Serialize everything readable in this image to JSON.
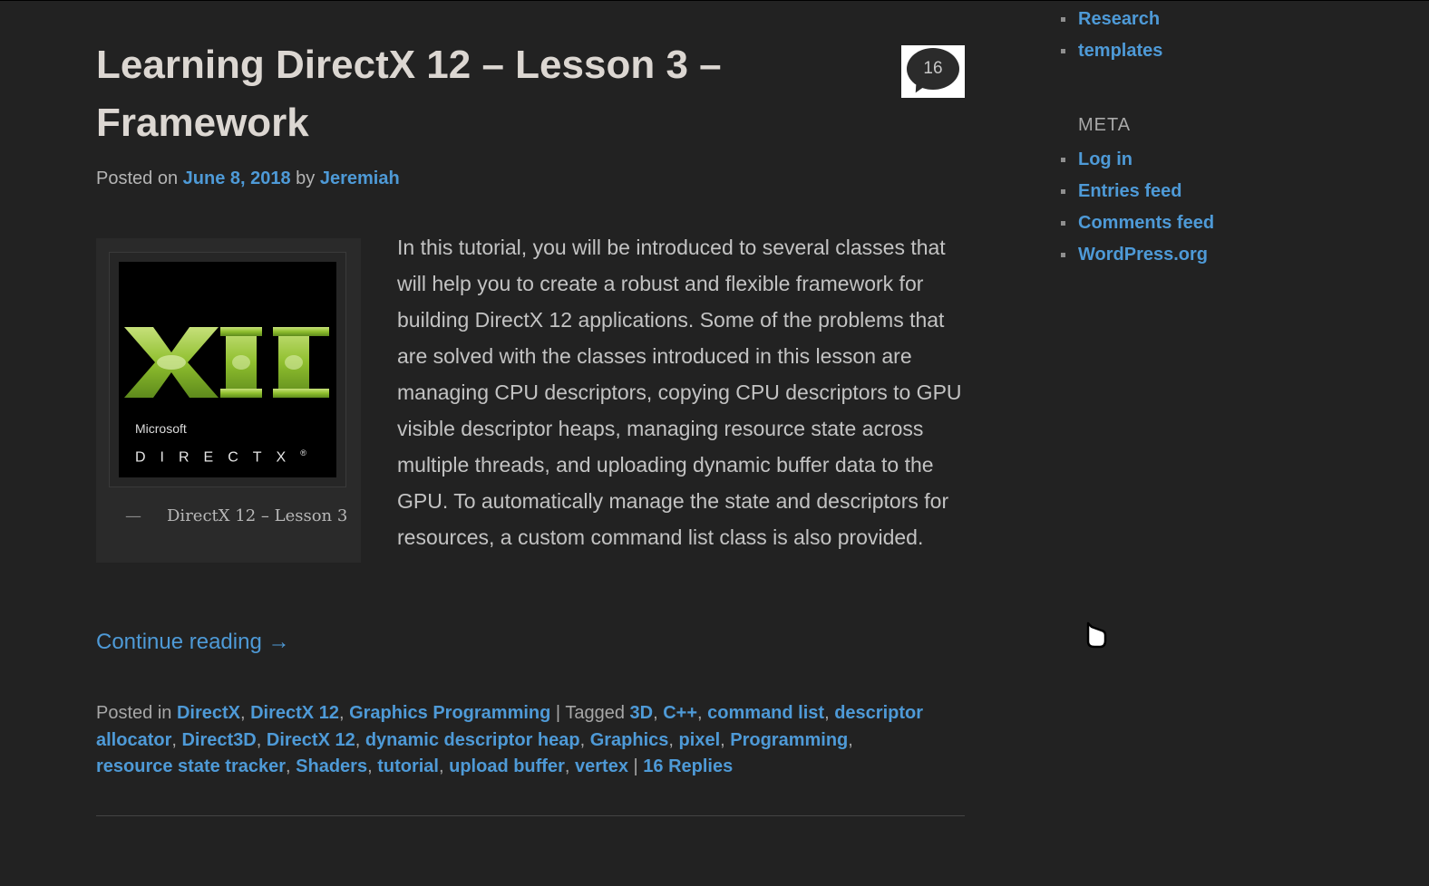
{
  "post": {
    "title": "Learning DirectX 12 – Lesson 3 – Framework",
    "comment_count": "16",
    "posted_on_label": "Posted on",
    "date": "June 8, 2018",
    "by_label": "by",
    "author": "Jeremiah",
    "image_caption": "DirectX 12 – Lesson 3",
    "image_caption_dash": "—",
    "logo_microsoft": "Microsoft",
    "logo_directx": "DIRECTX",
    "logo_registered": "®",
    "excerpt": "In this tutorial, you will be introduced to several classes that will help you to create a robust and flexible framework for building DirectX 12 applications. Some of the problems that are solved with the classes introduced in this lesson are managing CPU descriptors, copying CPU descriptors to GPU visible descriptor heaps, managing resource state across multiple threads, and uploading dynamic buffer data to the GPU. To automatically manage the state and descriptors for resources, a custom command list class is also provided.",
    "continue_reading": "Continue reading →",
    "posted_in_label": "Posted in",
    "categories": [
      "DirectX",
      "DirectX 12",
      "Graphics Programming"
    ],
    "tagged_label": "Tagged",
    "tags": [
      "3D",
      "C++",
      "command list",
      "descriptor allocator",
      "Direct3D",
      "DirectX 12",
      "dynamic descriptor heap",
      "Graphics",
      "pixel",
      "Programming",
      "resource state tracker",
      "Shaders",
      "tutorial",
      "upload buffer",
      "vertex"
    ],
    "replies": "16 Replies",
    "separator": "|"
  },
  "sidebar": {
    "top_items": [
      "Research",
      "templates"
    ],
    "meta_title": "META",
    "meta_items": [
      "Log in",
      "Entries feed",
      "Comments feed",
      "WordPress.org"
    ]
  },
  "colors": {
    "background": "#222222",
    "link": "#4e9ad7",
    "title": "#dcd7d2",
    "text": "#c3c3c3",
    "logo_green": "#8fbf2e"
  },
  "icons": {
    "comment_bubble": "speech-bubble-icon",
    "list_bullet": "square-bullet-icon",
    "cursor": "hand-cursor-icon"
  }
}
